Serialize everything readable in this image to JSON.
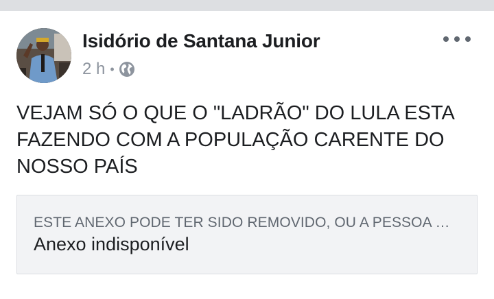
{
  "post": {
    "author": "Isidório de Santana Junior",
    "time": "2 h",
    "separator": "•",
    "privacy_icon": "globe-icon",
    "more_icon": "more-options-icon",
    "text": "VEJAM SÓ O QUE O \"LADRÃO\" DO LULA ESTA\nFAZENDO COM A POPULAÇÃO CARENTE DO\nNOSSO PAÍS",
    "attachment": {
      "title": "ESTE ANEXO PODE TER SIDO REMOVIDO, OU A PESSOA QUE O COMPARTILHOU NÃO TEM PERMISSÃO PARA COMPARTILHÁ-LO COM VOCÊ.",
      "subtitle": "Anexo indisponível"
    }
  },
  "colors": {
    "background": "#ffffff",
    "top_strip": "#dddfe2",
    "meta_text": "#8d949e",
    "attachment_bg": "#f2f3f5"
  }
}
